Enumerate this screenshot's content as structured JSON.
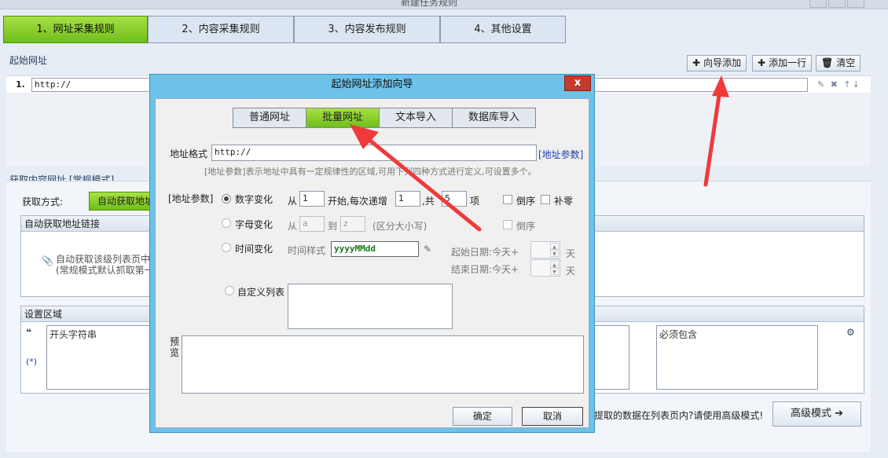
{
  "window": {
    "title": "新建任务规则"
  },
  "steps": [
    "1、网址采集规则",
    "2、内容采集规则",
    "3、内容发布规则",
    "4、其他设置"
  ],
  "start_url": {
    "section_title": "起始网址",
    "wizard_add": "向导添加",
    "add_row": "添加一行",
    "clear": "清空",
    "row_number": "1.",
    "row_value": "http://",
    "row_controls": "✎ ✖ ↑↓"
  },
  "content_url": {
    "section_title": "获取内容网址 [常规模式]",
    "method_label": "获取方式:",
    "method_value": "自动获取地址",
    "auto_panel_title": "自动获取地址链接",
    "auto_desc_1": "自动获取该级列表页中",
    "auto_desc_2": "(常规模式默认抓取第一",
    "settings_title": "设置区域",
    "quote_icon": "❝",
    "star_icon": "(*)",
    "start_string": "开头字符串",
    "must_include": "必须包含",
    "bottom_hint": "提取的数据在列表页内?请使用高级模式!",
    "advanced_mode": "高级模式 ➔"
  },
  "dialog": {
    "title": "起始网址添加向导",
    "close": "x",
    "tabs": [
      "普通网址",
      "批量网址",
      "文本导入",
      "数据库导入"
    ],
    "active_tab": 1,
    "format_label": "地址格式",
    "format_value": "http://",
    "param_link": "[地址参数]",
    "format_hint": "[地址参数]表示地址中具有一定规律性的区域,可用下列四种方式进行定义,可设置多个。",
    "param_label": "[地址参数]",
    "number": {
      "label": "数字变化",
      "from": "从",
      "start_value": "1",
      "start_text": "开始,每次递增",
      "step_value": "1",
      "total_text": ",共",
      "count_value": "5",
      "unit": "项",
      "reverse": "倒序",
      "pad_zero": "补零"
    },
    "letter": {
      "label": "字母变化",
      "from": "从",
      "from_value": "a",
      "to": "到",
      "to_value": "z",
      "case_note": "(区分大小写)",
      "reverse": "倒序"
    },
    "time": {
      "label": "时间变化",
      "style_label": "时间样式",
      "style_value": "yyyyMMdd",
      "start_label": "起始日期:今天+",
      "end_label": "结束日期:今天+",
      "day_unit": "天"
    },
    "custom_list": "自定义列表",
    "preview_label": "预\n览",
    "ok": "确定",
    "cancel": "取消"
  },
  "colors": {
    "active_green": "#7cc924",
    "dialog_blue": "#6dc2ea",
    "arrow_red": "#f03a3a"
  }
}
